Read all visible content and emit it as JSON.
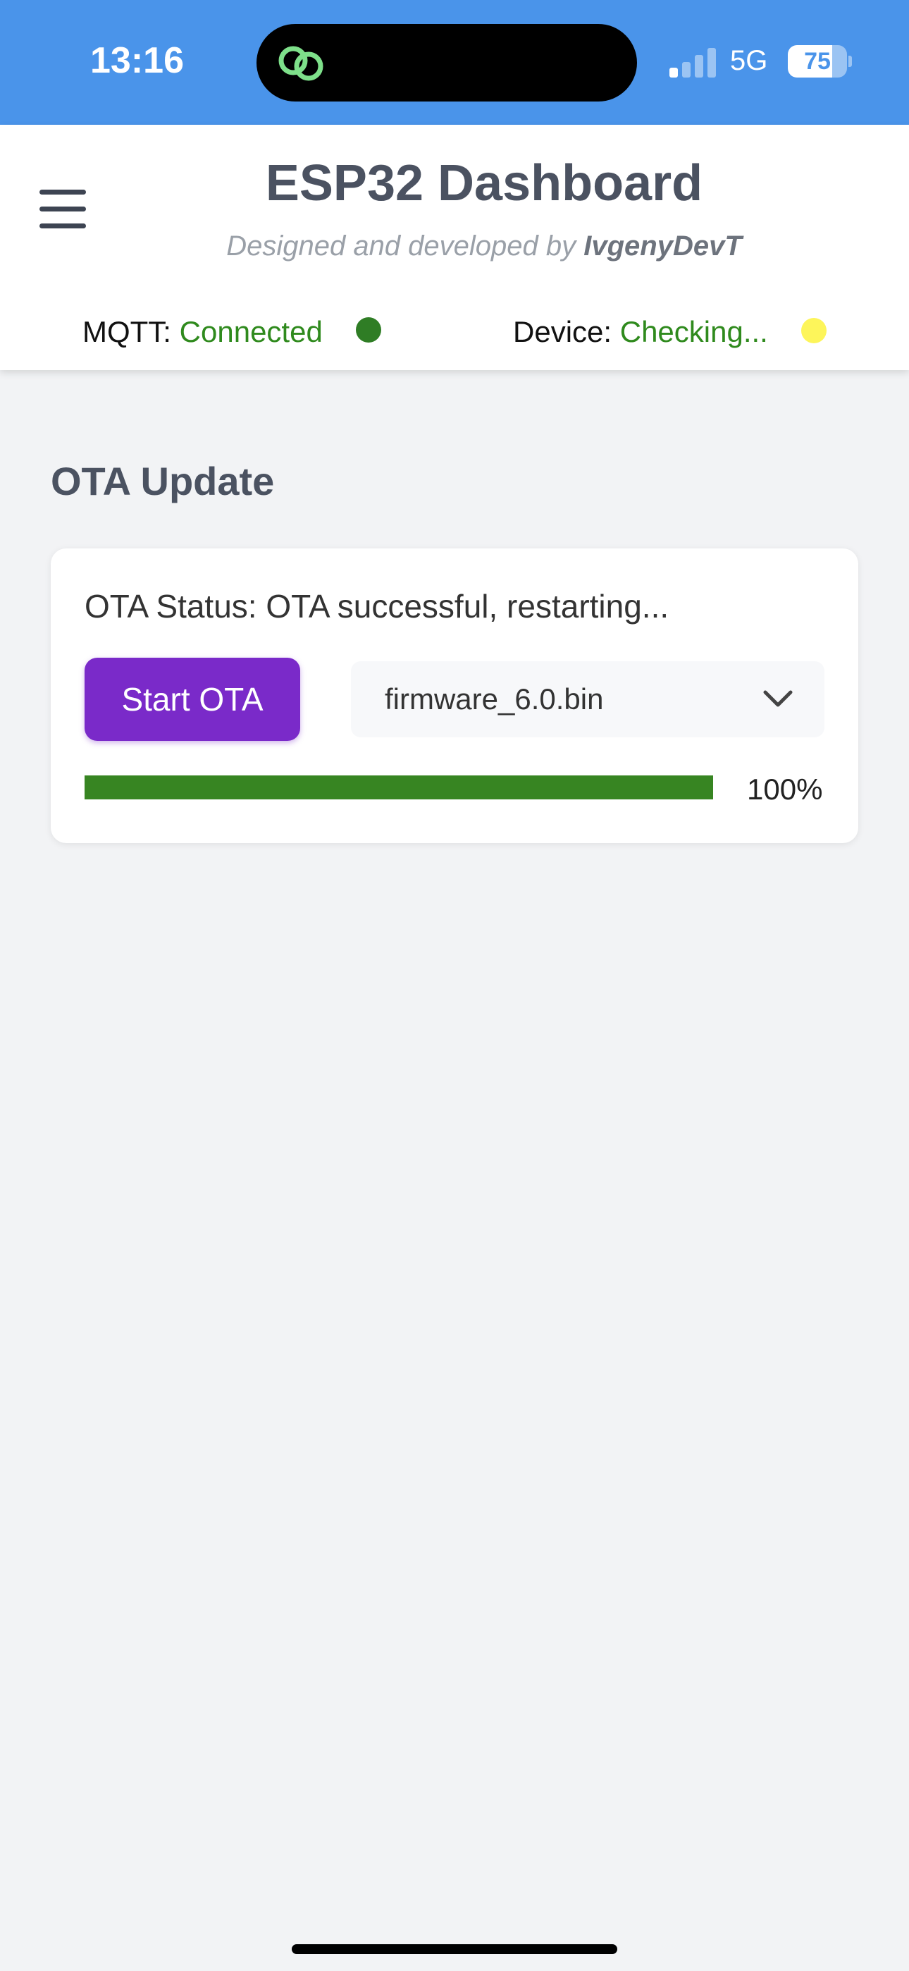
{
  "status_bar": {
    "time": "13:16",
    "network": "5G",
    "battery": "75",
    "battery_level": 0.75,
    "signal_bars_active": 1,
    "island_app_icon": "link-icon"
  },
  "header": {
    "title": "ESP32 Dashboard",
    "subtitle_prefix": "Designed and developed by",
    "subtitle_author": "IvgenyDevT",
    "menu_icon": "hamburger-menu-icon"
  },
  "connection": {
    "mqtt_label": "MQTT:",
    "mqtt_value": "Connected",
    "mqtt_dot_color": "#2f7d25",
    "device_label": "Device:",
    "device_value": "Checking...",
    "device_dot_color": "#fdf55a"
  },
  "ota": {
    "section_title": "OTA Update",
    "status_text": "OTA Status: OTA successful, restarting...",
    "start_button_label": "Start OTA",
    "selected_firmware": "firmware_6.0.bin",
    "progress_percent": 100,
    "progress_label": "100%"
  },
  "colors": {
    "status_bar_bg": "#4a94ea",
    "accent_purple": "#7a2ac9",
    "success_green": "#378522",
    "connected_text_green": "#2f8a1d"
  }
}
